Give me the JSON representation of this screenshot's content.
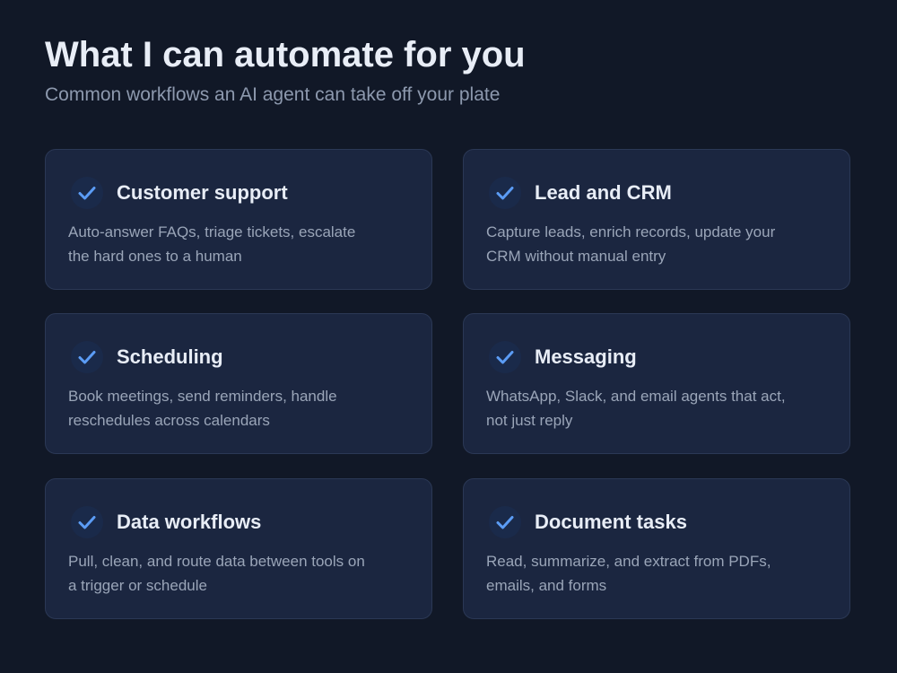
{
  "header": {
    "title": "What I can automate for you",
    "subtitle": "Common workflows an AI agent can take off your plate"
  },
  "colors": {
    "background": "#111827",
    "card": "#1b2640",
    "check_accent": "#5b9cf5"
  },
  "cards": [
    {
      "icon": "check-icon",
      "title": "Customer support",
      "description": "Auto-answer FAQs, triage tickets, escalate the hard ones to a human"
    },
    {
      "icon": "check-icon",
      "title": "Lead and CRM",
      "description": "Capture leads, enrich records, update your CRM without manual entry"
    },
    {
      "icon": "check-icon",
      "title": "Scheduling",
      "description": "Book meetings, send reminders, handle reschedules across calendars"
    },
    {
      "icon": "check-icon",
      "title": "Messaging",
      "description": "WhatsApp, Slack, and email agents that act, not just reply"
    },
    {
      "icon": "check-icon",
      "title": "Data workflows",
      "description": "Pull, clean, and route data between tools on a trigger or schedule"
    },
    {
      "icon": "check-icon",
      "title": "Document tasks",
      "description": "Read, summarize, and extract from PDFs, emails, and forms"
    }
  ]
}
